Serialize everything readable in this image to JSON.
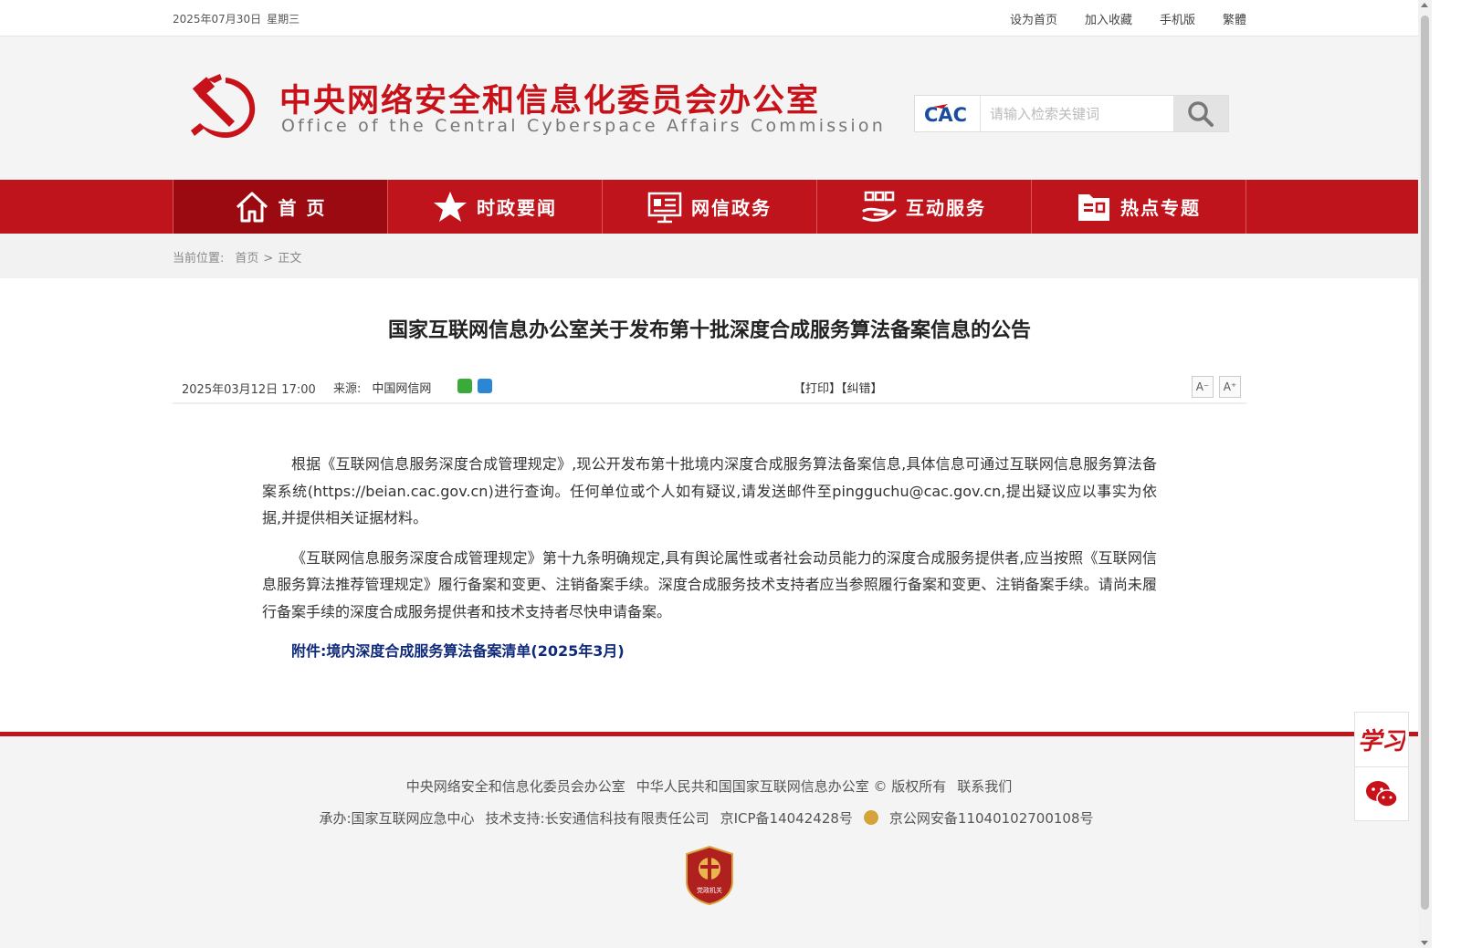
{
  "topbar": {
    "date": "2025年07月30日",
    "weekday": "星期三",
    "links": [
      "设为首页",
      "加入收藏",
      "手机版",
      "繁體"
    ]
  },
  "header": {
    "title_cn": "中央网络安全和信息化委员会办公室",
    "title_en": "Office of the Central Cyberspace Affairs Commission",
    "search_logo": "CAC",
    "search_placeholder": "请输入检索关键词"
  },
  "nav": {
    "items": [
      {
        "label": "首 页",
        "icon": "home-icon"
      },
      {
        "label": "时政要闻",
        "icon": "star-icon"
      },
      {
        "label": "网信政务",
        "icon": "presentation-icon"
      },
      {
        "label": "互动服务",
        "icon": "hand-service-icon"
      },
      {
        "label": "热点专题",
        "icon": "folder-icon"
      }
    ],
    "active_index": 0
  },
  "breadcrumb": {
    "label": "当前位置:",
    "home": "首页",
    "separator": ">",
    "current": "正文"
  },
  "article": {
    "title": "国家互联网信息办公室关于发布第十批深度合成服务算法备案信息的公告",
    "datetime": "2025年03月12日 17:00",
    "source_label": "来源:",
    "source": "中国网信网",
    "tools": "【打印】【纠错】",
    "font_smaller": "A⁻",
    "font_larger": "A⁺",
    "paragraphs": [
      "根据《互联网信息服务深度合成管理规定》,现公开发布第十批境内深度合成服务算法备案信息,具体信息可通过互联网信息服务算法备案系统(https://beian.cac.gov.cn)进行查询。任何单位或个人如有疑议,请发送邮件至pingguchu@cac.gov.cn,提出疑议应以事实为依据,并提供相关证据材料。",
      "《互联网信息服务深度合成管理规定》第十九条明确规定,具有舆论属性或者社会动员能力的深度合成服务提供者,应当按照《互联网信息服务算法推荐管理规定》履行备案和变更、注销备案手续。深度合成服务技术支持者应当参照履行备案和变更、注销备案手续。请尚未履行备案手续的深度合成服务提供者和技术支持者尽快申请备案。"
    ],
    "attachment": "附件:境内深度合成服务算法备案清单(2025年3月)"
  },
  "footer": {
    "line1": [
      "中央网络安全和信息化委员会办公室",
      "中华人民共和国国家互联网信息办公室 © 版权所有",
      "联系我们"
    ],
    "line2": [
      "承办:国家互联网应急中心",
      "技术支持:长安通信科技有限责任公司",
      "京ICP备14042428号",
      "京公网安备11040102700108号"
    ],
    "badge_text": "党政机关"
  },
  "side": {
    "xuexi": "学习"
  },
  "colors": {
    "brand_red": "#c0141c",
    "nav_active": "#9a0a10",
    "attachment_blue": "#0f2a7a"
  }
}
